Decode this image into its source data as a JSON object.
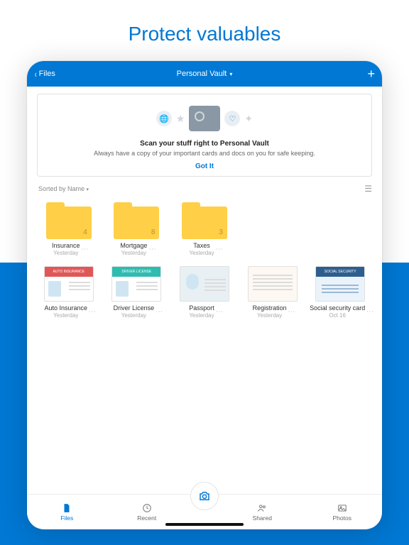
{
  "hero": {
    "title": "Protect valuables"
  },
  "nav": {
    "back": "Files",
    "title": "Personal Vault",
    "add": "+"
  },
  "banner": {
    "heading": "Scan your stuff right to Personal Vault",
    "sub": "Always have a copy of your important cards and docs on you for safe keeping.",
    "cta": "Got It"
  },
  "sort": {
    "label": "Sorted by Name"
  },
  "folders": [
    {
      "name": "Insurance",
      "date": "Yesterday",
      "count": "4"
    },
    {
      "name": "Mortgage",
      "date": "Yesterday",
      "count": "8"
    },
    {
      "name": "Taxes",
      "date": "Yesterday",
      "count": "3"
    }
  ],
  "files": [
    {
      "name": "Auto Insurance",
      "date": "Yesterday",
      "head": "hd-red",
      "tag": "AUTO INSURANCE"
    },
    {
      "name": "Driver License",
      "date": "Yesterday",
      "head": "hd-teal",
      "tag": "DRIVER LICENSE"
    },
    {
      "name": "Passport",
      "date": "Yesterday",
      "head": "hd-blue",
      "tag": ""
    },
    {
      "name": "Registration",
      "date": "Yesterday",
      "head": "",
      "tag": ""
    },
    {
      "name": "Social security card",
      "date": "Oct 16",
      "head": "hd-navy",
      "tag": "SOCIAL SECURITY"
    }
  ],
  "tabs": {
    "files": "Files",
    "recent": "Recent",
    "shared": "Shared",
    "photos": "Photos"
  }
}
